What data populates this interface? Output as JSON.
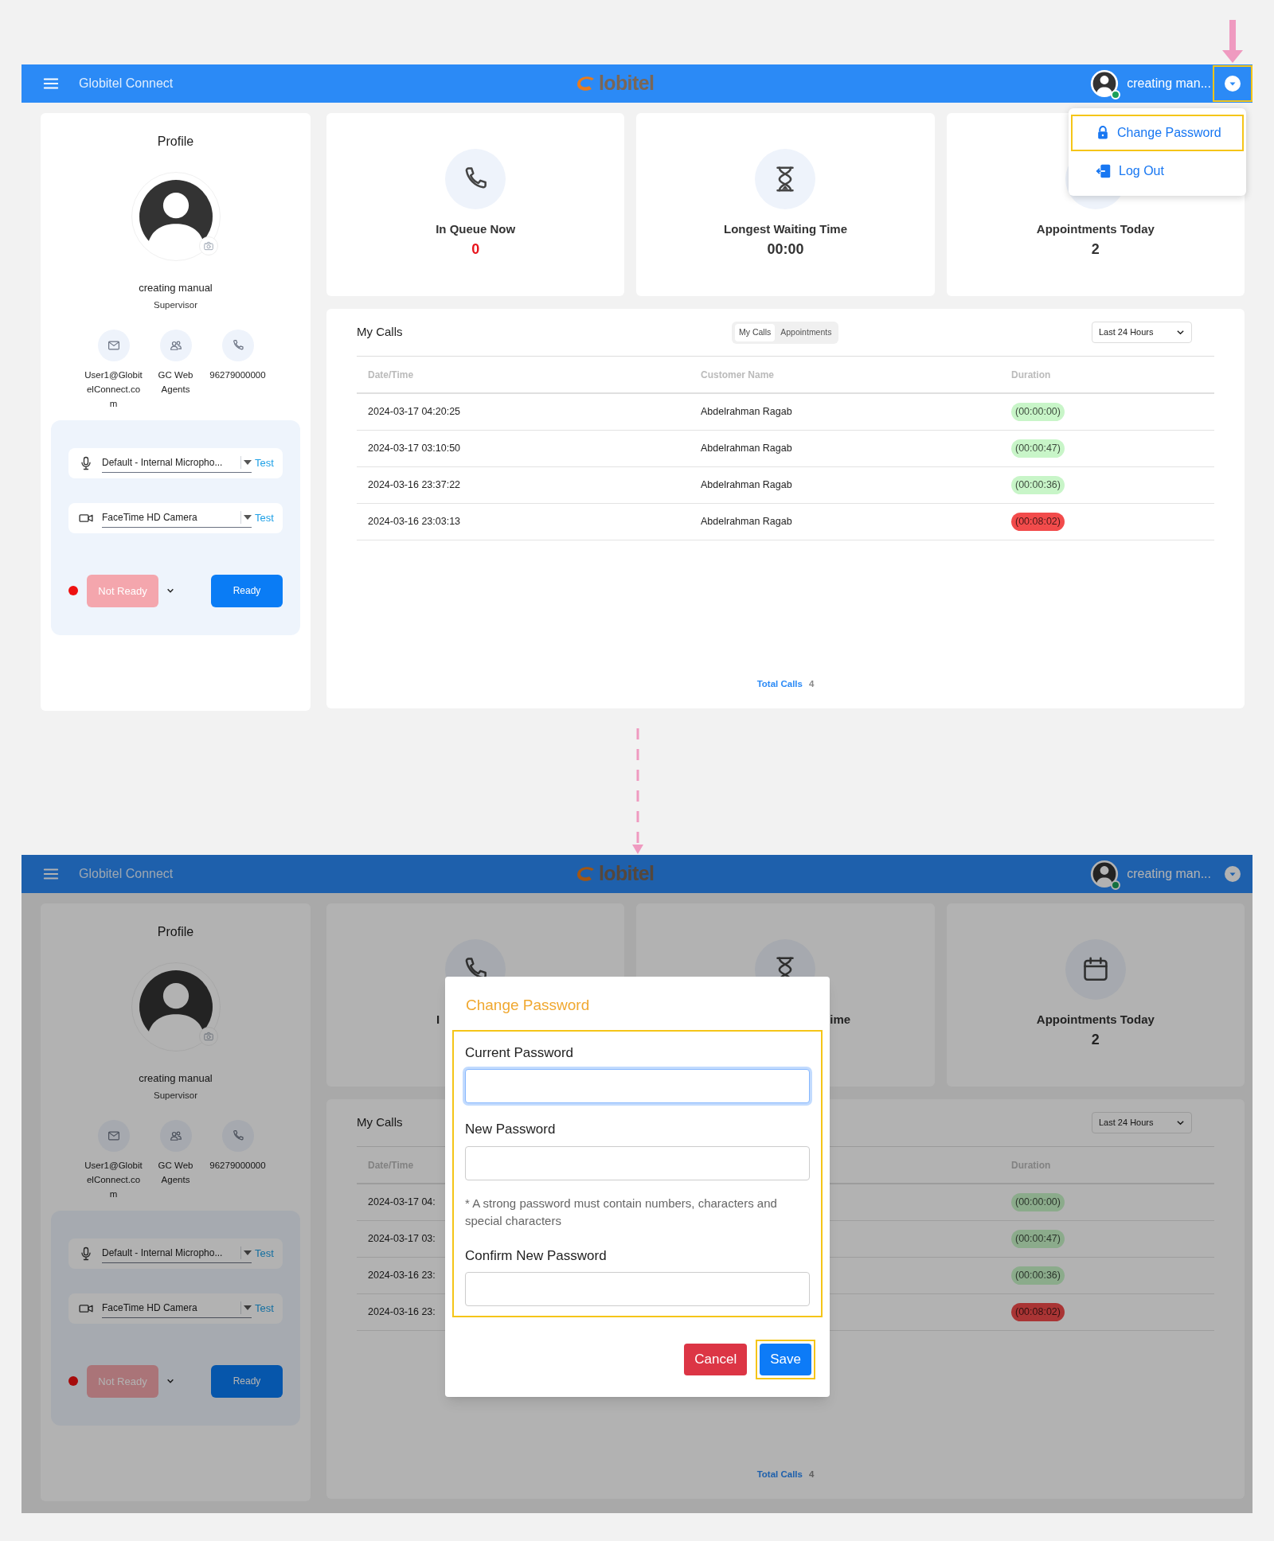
{
  "screens": [
    {
      "header": {
        "title": "Globitel Connect",
        "logo": "lobitel",
        "user": "creating man...",
        "menu_button_highlighted": true
      },
      "user_menu": {
        "items": [
          {
            "kind": "lock",
            "label": "Change Password",
            "highlighted": true
          },
          {
            "kind": "logout",
            "label": "Log Out",
            "highlighted": false
          }
        ]
      },
      "profile": {
        "title": "Profile",
        "name": "creating manual",
        "role": "Supervisor",
        "contacts": [
          {
            "kind": "email",
            "text": "User1@GlobitelConnect.com"
          },
          {
            "kind": "group",
            "text": "GC Web Agents"
          },
          {
            "kind": "phone",
            "text": "96279000000"
          }
        ],
        "devices": [
          {
            "kind": "microphone",
            "value": "Default - Internal Micropho...",
            "action": "Test"
          },
          {
            "kind": "camera",
            "value": "FaceTime HD Camera",
            "action": "Test"
          }
        ],
        "status_buttons": [
          {
            "kind": "not_ready",
            "label": "Not Ready"
          },
          {
            "kind": "ready",
            "label": "Ready"
          }
        ]
      },
      "stats": [
        {
          "kind": "phone",
          "label": "In Queue Now",
          "value": "0",
          "alert": true
        },
        {
          "kind": "hourglass",
          "label": "Longest Waiting Time",
          "value": "00:00",
          "alert": false
        },
        {
          "label": "Appointments Today",
          "value": "2",
          "alert": false
        }
      ],
      "calls": {
        "title": "My Calls",
        "tabs": [
          {
            "label": "My Calls",
            "selected": true
          },
          {
            "label": "Appointments",
            "selected": false
          }
        ],
        "range": "Last 24 Hours",
        "columns": {
          "date": "Date/Time",
          "customer": "Customer Name",
          "duration": "Duration"
        },
        "rows": [
          {
            "date": "2024-03-17 04:20:25",
            "customer": "Abdelrahman Ragab",
            "duration": "(00:00:00)",
            "color": "#c8f5c8"
          },
          {
            "date": "2024-03-17 03:10:50",
            "customer": "Abdelrahman Ragab",
            "duration": "(00:00:47)",
            "color": "#c8f5c8"
          },
          {
            "date": "2024-03-16 23:37:22",
            "customer": "Abdelrahman Ragab",
            "duration": "(00:00:36)",
            "color": "#c8f5c8"
          },
          {
            "date": "2024-03-16 23:03:13",
            "customer": "Abdelrahman Ragab",
            "duration": "(00:08:02)",
            "color": "#f24b4b"
          }
        ],
        "total_label": "Total Calls",
        "total": "4"
      }
    },
    {
      "header": {
        "title": "Globitel Connect",
        "logo": "lobitel",
        "user": "creating man...",
        "menu_button_highlighted": false
      },
      "profile": {
        "title": "Profile",
        "name": "creating manual",
        "role": "Supervisor",
        "contacts": [
          {
            "kind": "email",
            "text": "User1@GlobitelConnect.com"
          },
          {
            "kind": "group",
            "text": "GC Web Agents"
          },
          {
            "kind": "phone",
            "text": "96279000000"
          }
        ],
        "devices": [
          {
            "kind": "microphone",
            "value": "Default - Internal Micropho...",
            "action": "Test"
          },
          {
            "kind": "camera",
            "value": "FaceTime HD Camera",
            "action": "Test"
          }
        ],
        "status_buttons": [
          {
            "kind": "not_ready",
            "label": "Not Ready"
          },
          {
            "kind": "ready",
            "label": "Ready"
          }
        ]
      },
      "stats": [
        {
          "kind": "phone",
          "label": "I"
        },
        {
          "kind": "hourglass",
          "label": "ime"
        },
        {
          "kind": "calendar",
          "label": "Appointments Today",
          "value": "2",
          "alert": false
        }
      ],
      "calls": {
        "title": "My Calls",
        "range": "Last 24 Hours",
        "columns": {
          "date": "Date/Time",
          "duration": "Duration"
        },
        "rows": [
          {
            "date": "2024-03-17 04:",
            "duration": "(00:00:00)",
            "long": false
          },
          {
            "date": "2024-03-17 03:",
            "duration": "(00:00:47)",
            "long": false
          },
          {
            "date": "2024-03-16 23:",
            "duration": "(00:00:36)",
            "long": false
          },
          {
            "date": "2024-03-16 23:",
            "duration": "(00:08:02)",
            "long": true
          }
        ],
        "total_label": "Total Calls",
        "total": "4"
      },
      "modal": {
        "title": "Change Password",
        "form_highlighted": true,
        "fields": [
          {
            "label": "Current Password",
            "focused": true
          },
          {
            "label": "New Password",
            "focused": false,
            "hint": "* A strong password must contain numbers, characters and special characters"
          },
          {
            "label": "Confirm New Password",
            "focused": false
          }
        ],
        "buttons": [
          {
            "kind": "cancel",
            "label": "Cancel",
            "highlighted": false
          },
          {
            "kind": "save",
            "label": "Save",
            "highlighted": true
          }
        ]
      }
    }
  ]
}
